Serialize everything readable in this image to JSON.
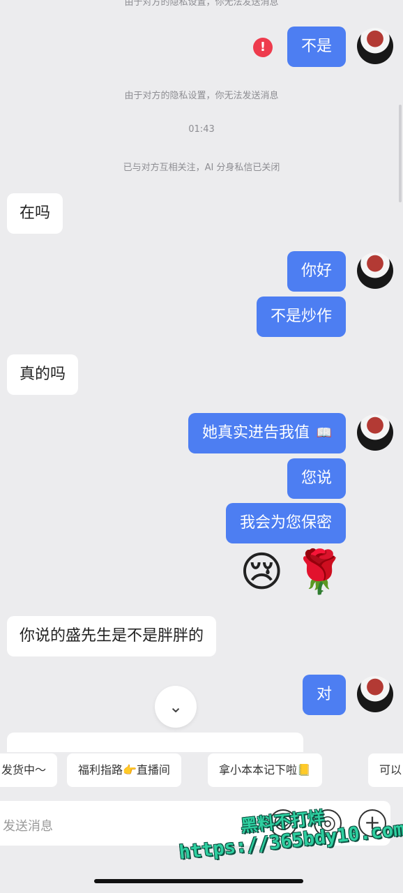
{
  "system_messages": {
    "top_cut": "由于对方的隐私设置，你无法发送消息",
    "privacy": "由于对方的隐私设置，你无法发送消息",
    "time": "01:43",
    "follow": "已与对方互相关注，AI 分身私信已关闭"
  },
  "messages": [
    {
      "side": "out",
      "text": "不是",
      "error": true
    },
    {
      "side": "in",
      "text": "在吗"
    },
    {
      "side": "out",
      "text": "你好"
    },
    {
      "side": "out",
      "text": "不是炒作"
    },
    {
      "side": "in",
      "text": "真的吗"
    },
    {
      "side": "out",
      "text": "她真实进告我值"
    },
    {
      "side": "out",
      "text": "您说"
    },
    {
      "side": "out",
      "text": "我会为您保密"
    },
    {
      "side": "out",
      "text": "😢🌹"
    },
    {
      "side": "in",
      "text": "你说的盛先生是不是胖胖的"
    },
    {
      "side": "out",
      "text": "对"
    }
  ],
  "icons": {
    "error": "!",
    "scroll_down": "⌄",
    "sticker_ask": "📖",
    "plus": "+"
  },
  "quick_replies": [
    "发货中～",
    "福利指路👉直播间",
    "拿小本本记下啦📒",
    "可以"
  ],
  "input": {
    "placeholder": "发送消息"
  },
  "watermark": {
    "line1": "黑料不打烊",
    "line2": "https://365bdy10.com"
  },
  "colors": {
    "outgoing": "#4d7ef2",
    "incoming": "#ffffff",
    "background": "#ececee",
    "error": "#ee3b4d"
  }
}
